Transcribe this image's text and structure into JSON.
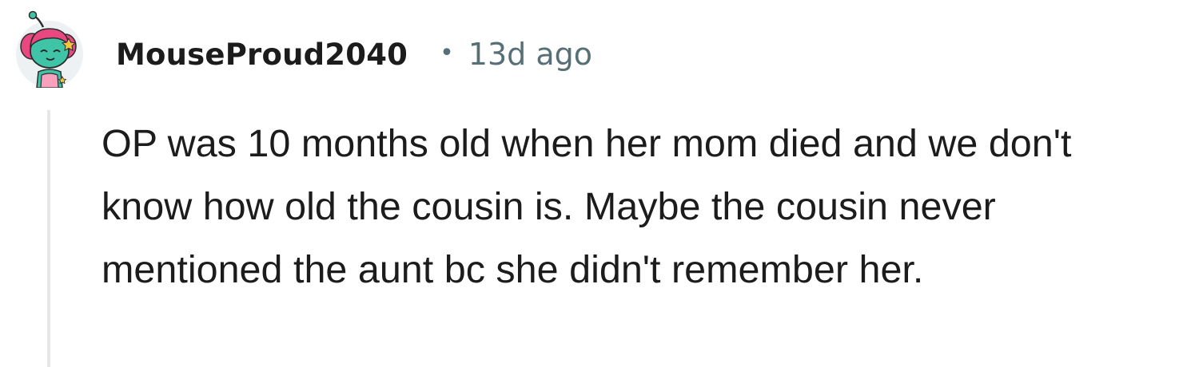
{
  "comment": {
    "username": "MouseProud2040",
    "separator": "•",
    "timestamp": "13d ago",
    "body": "OP was 10 months old when her mom died and we don't know how old the cousin is. Maybe the cousin never mentioned the aunt bc she didn't remember her."
  },
  "avatar": {
    "icon": "snoo-avatar-icon",
    "colors": {
      "hair": "#e8477f",
      "skin": "#3fc4a8",
      "outfit": "#f7a1bf",
      "accent": "#f5c542",
      "background": "#eef1f3"
    }
  },
  "colors": {
    "text": "#1c1c1c",
    "meta": "#576f76",
    "thread_line": "#e4e6e8"
  }
}
